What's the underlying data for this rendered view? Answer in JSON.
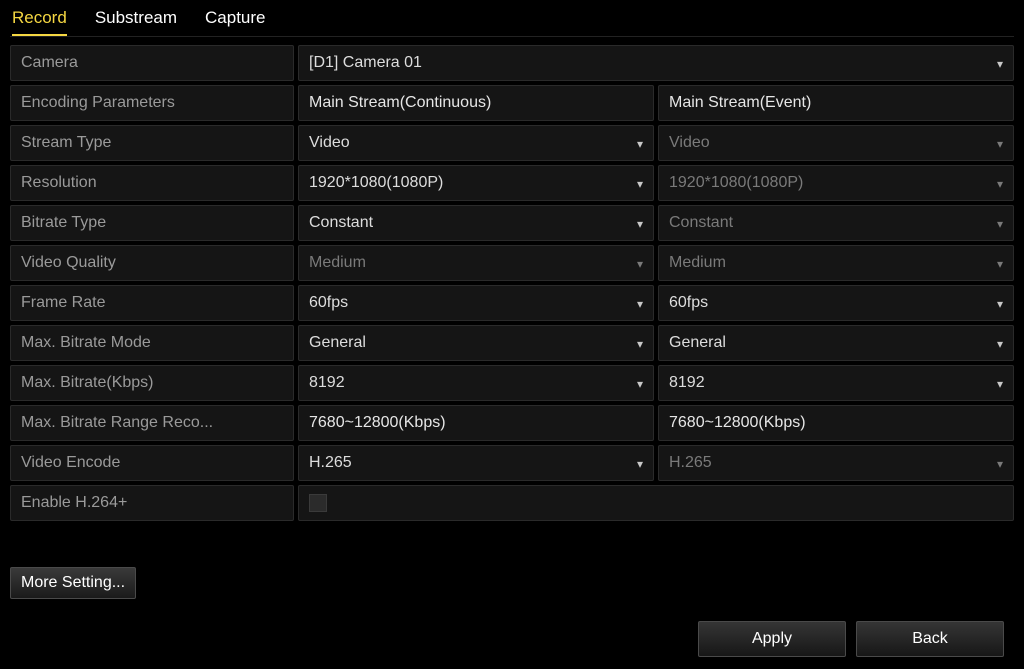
{
  "tabs": {
    "record": "Record",
    "substream": "Substream",
    "capture": "Capture"
  },
  "camera": {
    "label": "Camera",
    "value": "[D1] Camera 01"
  },
  "headers": {
    "encoding_params": "Encoding Parameters",
    "continuous": "Main Stream(Continuous)",
    "event": "Main Stream(Event)"
  },
  "rows": {
    "stream_type": {
      "label": "Stream Type",
      "c": "Video",
      "e": "Video"
    },
    "resolution": {
      "label": "Resolution",
      "c": "1920*1080(1080P)",
      "e": "1920*1080(1080P)"
    },
    "bitrate_type": {
      "label": "Bitrate Type",
      "c": "Constant",
      "e": "Constant"
    },
    "video_quality": {
      "label": "Video Quality",
      "c": "Medium",
      "e": "Medium"
    },
    "frame_rate": {
      "label": "Frame Rate",
      "c": "60fps",
      "e": "60fps"
    },
    "max_bitrate_mode": {
      "label": "Max. Bitrate Mode",
      "c": "General",
      "e": "General"
    },
    "max_bitrate_kbps": {
      "label": "Max. Bitrate(Kbps)",
      "c": "8192",
      "e": "8192"
    },
    "max_bitrate_range": {
      "label": "Max. Bitrate Range Reco...",
      "c": "7680~12800(Kbps)",
      "e": "7680~12800(Kbps)"
    },
    "video_encode": {
      "label": "Video Encode",
      "c": "H.265",
      "e": "H.265"
    }
  },
  "enable_h264plus": {
    "label": "Enable H.264+",
    "checked": false
  },
  "buttons": {
    "more_setting": "More Setting...",
    "apply": "Apply",
    "back": "Back"
  }
}
